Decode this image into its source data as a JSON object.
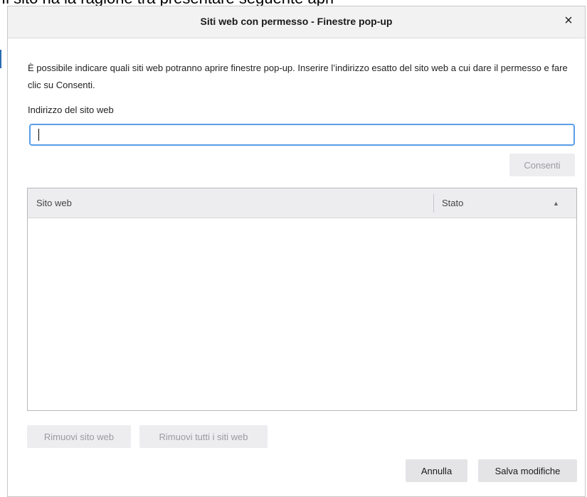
{
  "background": {
    "cropped_text": "Il sito ha la ragione tra presentare seguente apri"
  },
  "dialog": {
    "title": "Siti web con permesso - Finestre pop-up",
    "close_glyph": "×",
    "description": "È possibile indicare quali siti web potranno aprire finestre pop-up. Inserire l’indirizzo esatto del sito web a cui dare il permesso e fare clic su Consenti.",
    "address_label": "Indirizzo del sito web",
    "address_value": "",
    "consenti_label": "Consenti",
    "table": {
      "columns": [
        "Sito web",
        "Stato"
      ],
      "sort_icon": "▲",
      "rows": []
    },
    "remove_label": "Rimuovi sito web",
    "remove_all_label": "Rimuovi tutti i siti web",
    "cancel_label": "Annulla",
    "save_label": "Salva modifiche"
  },
  "colors": {
    "accent_focus": "#5a9de8",
    "titlebar_bg": "#f2f2f3",
    "button_bg": "#e4e4e7",
    "disabled_text": "#9b9ba0"
  }
}
